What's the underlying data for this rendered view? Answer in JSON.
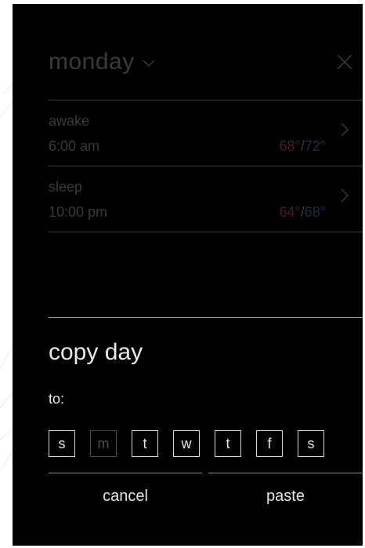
{
  "header": {
    "day": "monday",
    "close_icon": "close-icon",
    "chevron_icon": "chevron-down-icon"
  },
  "schedule": [
    {
      "name": "awake",
      "time": "6:00 am",
      "heat": "68°",
      "sep": "/",
      "cool": "72°"
    },
    {
      "name": "sleep",
      "time": "10:00 pm",
      "heat": "64°",
      "sep": "/",
      "cool": "68°"
    }
  ],
  "copy": {
    "title": "copy day",
    "to_label": "to:",
    "days": [
      {
        "label": "s",
        "enabled": true
      },
      {
        "label": "m",
        "enabled": false
      },
      {
        "label": "t",
        "enabled": true
      },
      {
        "label": "w",
        "enabled": true
      },
      {
        "label": "t",
        "enabled": true
      },
      {
        "label": "f",
        "enabled": true
      },
      {
        "label": "s",
        "enabled": true
      }
    ],
    "cancel_label": "cancel",
    "paste_label": "paste"
  },
  "colors": {
    "panel_bg": "#000000",
    "heat": "#4a1e1e",
    "cool": "#1c2f45",
    "text": "#e6e6e6",
    "dim_text": "#3a3a3a"
  }
}
